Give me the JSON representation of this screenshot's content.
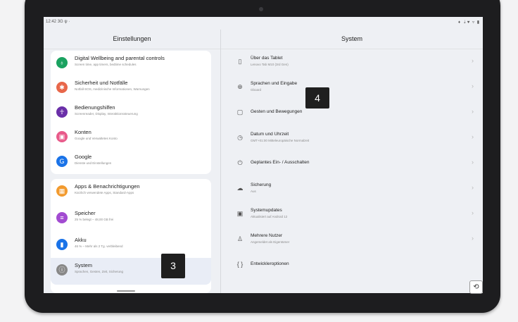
{
  "status_bar": {
    "time": "12:42",
    "left_icons": "3G ψ ·",
    "right_icons": "♦ ⇣♥ ▿ ▮"
  },
  "left_panel": {
    "title": "Einstellungen",
    "group1": [
      {
        "label": "Digital Wellbeing and parental controls",
        "subtitle": "Screen time, app timers, bedtime schedules",
        "icon": "wellbeing-icon",
        "color": "#1aa260"
      },
      {
        "label": "Sicherheit und Notfälle",
        "subtitle": "Notfall-SOS, medizinische Informationen, Warnungen",
        "icon": "emergency-icon",
        "color": "#e8674a"
      },
      {
        "label": "Bedienungshilfen",
        "subtitle": "Screenreader, Display, Interaktionssteuerung",
        "icon": "accessibility-icon",
        "color": "#6a2fa8"
      },
      {
        "label": "Konten",
        "subtitle": "Google und Verwaltetes Konto",
        "icon": "accounts-icon",
        "color": "#e85a8a"
      },
      {
        "label": "Google",
        "subtitle": "Dienste und Einstellungen",
        "icon": "google-icon",
        "color": "#1a73e8"
      }
    ],
    "group2": [
      {
        "label": "Apps & Benachrichtigungen",
        "subtitle": "Kürzlich verwendete Apps, Standard-Apps",
        "icon": "apps-icon",
        "color": "#f29a2e"
      },
      {
        "label": "Speicher",
        "subtitle": "25 % belegt – 48,00 GB frei",
        "icon": "storage-icon",
        "color": "#a24bd1"
      },
      {
        "label": "Akku",
        "subtitle": "46 % – Mehr als 2 Tg. verbleibend",
        "icon": "battery-icon",
        "color": "#1a73e8"
      },
      {
        "label": "System",
        "subtitle": "Sprachen, Gesten, Zeit, Sicherung",
        "icon": "system-icon",
        "color": "#888888"
      }
    ]
  },
  "right_panel": {
    "title": "System",
    "items": [
      {
        "label": "Über das Tablet",
        "subtitle": "Lenovo Tab M10 (3rd Gen)",
        "icon": "tablet-icon",
        "glyph": "▯"
      },
      {
        "label": "Sprachen und Eingabe",
        "subtitle": "Gboard",
        "icon": "globe-icon",
        "glyph": "⊕"
      },
      {
        "label": "Gesten und Bewegungen",
        "subtitle": "",
        "icon": "gesture-icon",
        "glyph": "▢"
      },
      {
        "label": "Datum und Uhrzeit",
        "subtitle": "GMT+01:00 Mitteleuropäische Normalzeit",
        "icon": "clock-icon",
        "glyph": "◷"
      },
      {
        "label": "Geplantes Ein- / Ausschalten",
        "subtitle": "",
        "icon": "power-icon",
        "glyph": "⏻"
      },
      {
        "label": "Sicherung",
        "subtitle": "Aus",
        "icon": "backup-icon",
        "glyph": "☁"
      },
      {
        "label": "Systemupdates",
        "subtitle": "Aktualisiert auf Android 12",
        "icon": "update-icon",
        "glyph": "▣"
      },
      {
        "label": "Mehrere Nutzer",
        "subtitle": "Angemeldet als Eigentümer",
        "icon": "users-icon",
        "glyph": "♙"
      },
      {
        "label": "Entwickleroptionen",
        "subtitle": "",
        "icon": "developer-icon",
        "glyph": "{ }"
      }
    ],
    "chevron": "›"
  },
  "annotations": {
    "left": "3",
    "right": "4"
  },
  "rotate_glyph": "⟲"
}
